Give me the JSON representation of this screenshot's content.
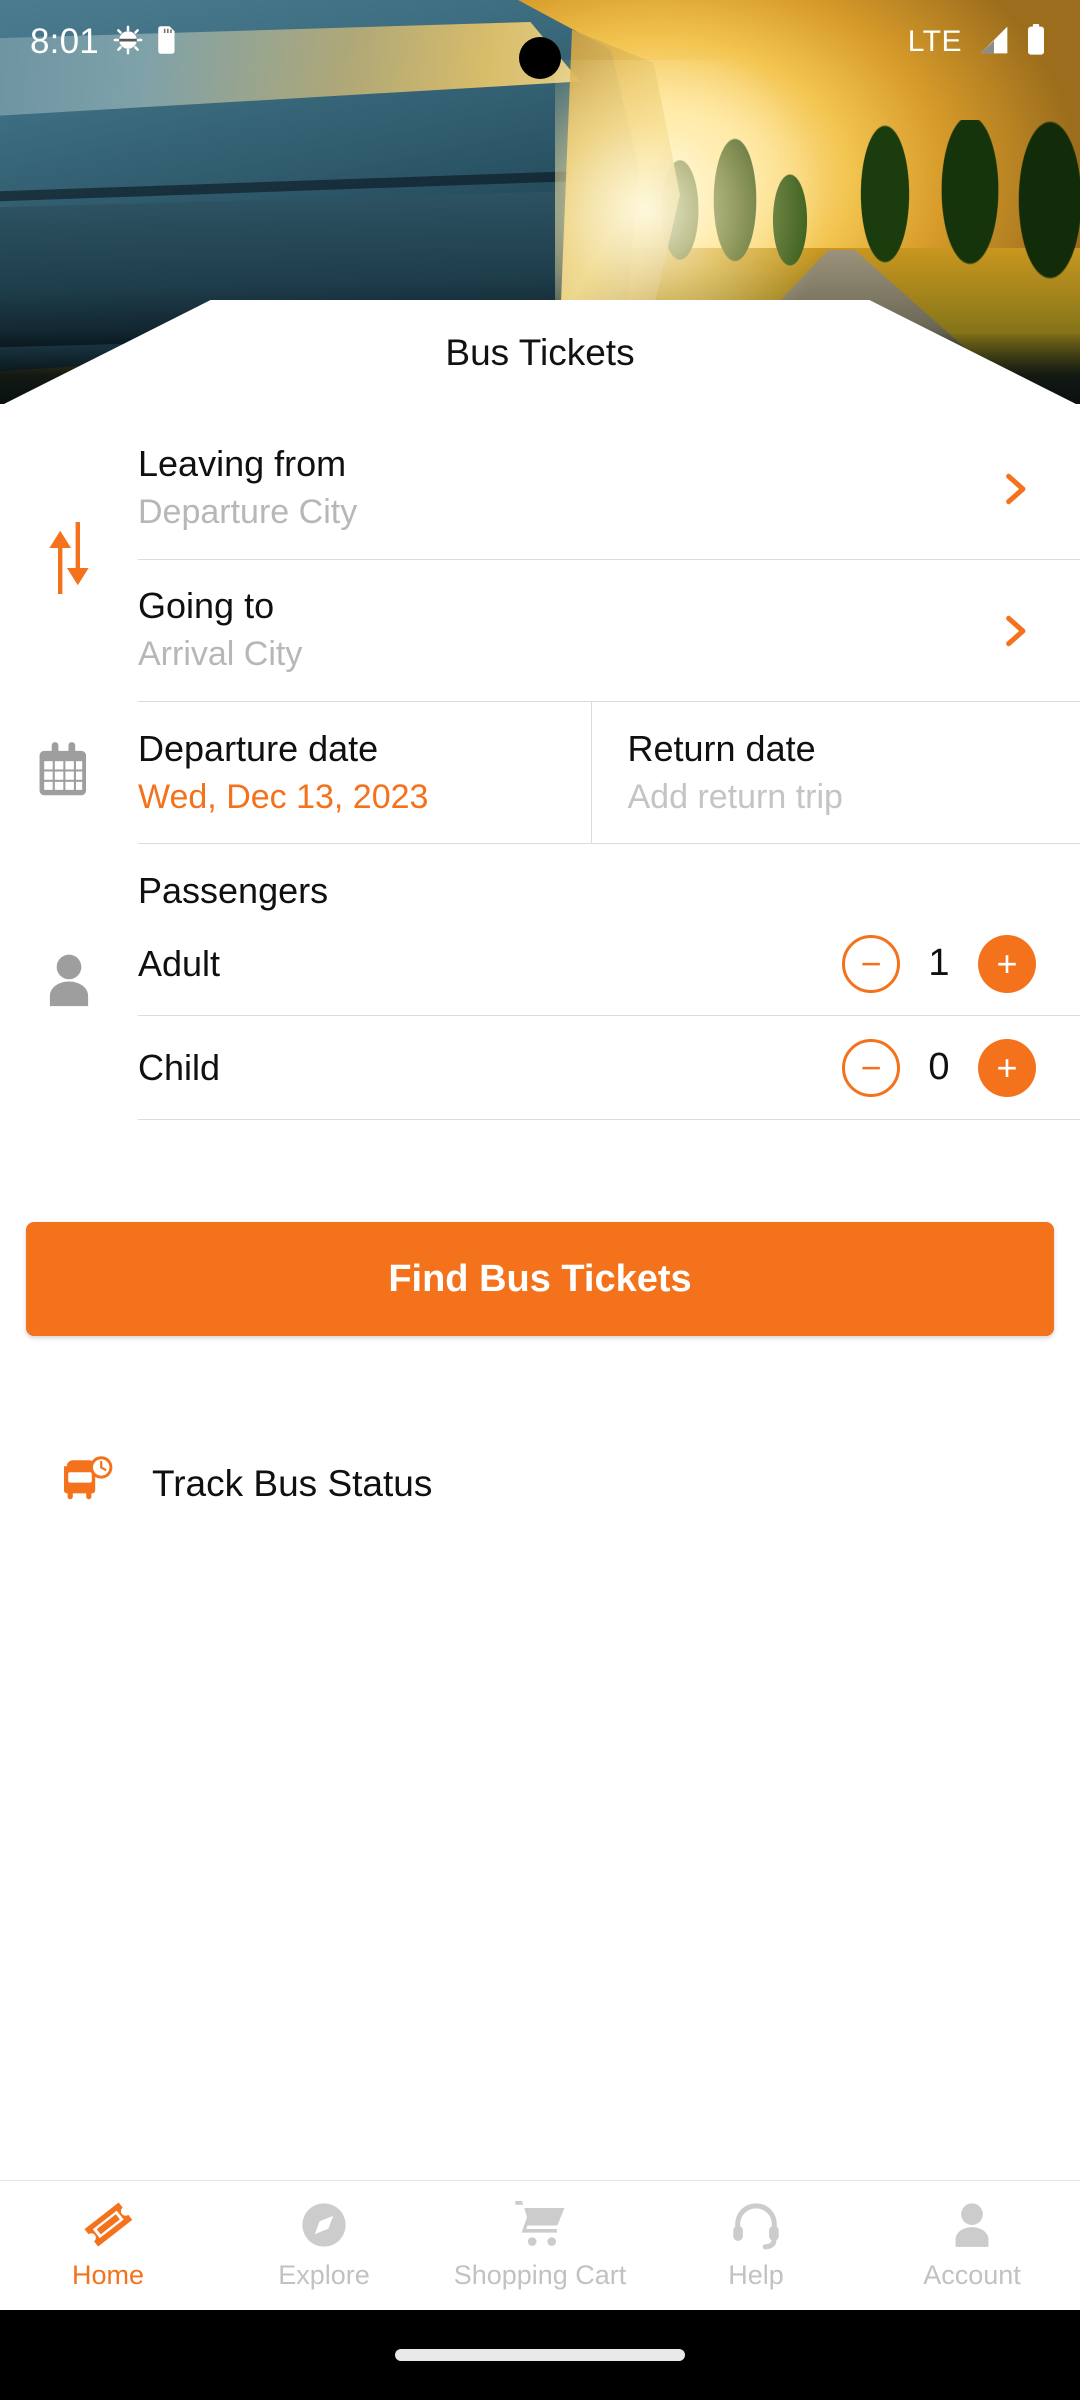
{
  "status_bar": {
    "time": "8:01",
    "icons_left": [
      "android-debug-icon",
      "sd-card-icon"
    ],
    "network_label": "LTE",
    "icons_right": [
      "signal-icon",
      "battery-icon"
    ]
  },
  "header": {
    "title": "Bus Tickets"
  },
  "search_form": {
    "swap_icon": "swap-vertical-icon",
    "leaving_from": {
      "label": "Leaving from",
      "placeholder": "Departure City",
      "chevron": "chevron-right-icon"
    },
    "going_to": {
      "label": "Going to",
      "placeholder": "Arrival City",
      "chevron": "chevron-right-icon"
    },
    "calendar_icon": "calendar-icon",
    "departure_date": {
      "label": "Departure date",
      "value": "Wed, Dec 13, 2023"
    },
    "return_date": {
      "label": "Return date",
      "value": "Add return trip"
    },
    "passengers": {
      "person_icon": "person-icon",
      "title": "Passengers",
      "rows": [
        {
          "label": "Adult",
          "count": "1",
          "minus": "−",
          "plus": "+"
        },
        {
          "label": "Child",
          "count": "0",
          "minus": "−",
          "plus": "+"
        }
      ]
    }
  },
  "cta": {
    "label": "Find Bus Tickets"
  },
  "track": {
    "icon": "bus-clock-icon",
    "label": "Track Bus Status"
  },
  "bottom_nav": {
    "items": [
      {
        "label": "Home",
        "icon": "ticket-icon",
        "active": true
      },
      {
        "label": "Explore",
        "icon": "compass-icon",
        "active": false
      },
      {
        "label": "Shopping Cart",
        "icon": "shopping-cart-icon",
        "active": false
      },
      {
        "label": "Help",
        "icon": "headset-icon",
        "active": false
      },
      {
        "label": "Account",
        "icon": "person-icon",
        "active": false
      }
    ]
  },
  "colors": {
    "accent": "#f4721b",
    "muted_text": "#b7b7b7",
    "primary_text": "#101010",
    "divider": "#dcdcdc"
  }
}
